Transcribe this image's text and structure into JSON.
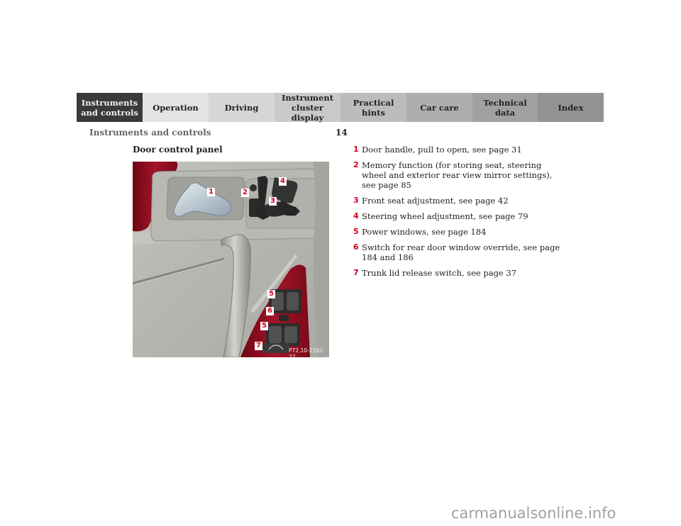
{
  "nav": {
    "tabs": [
      {
        "lines": [
          "Instruments",
          "and controls"
        ],
        "active": true
      },
      {
        "lines": [
          "Operation"
        ],
        "active": false
      },
      {
        "lines": [
          "Driving"
        ],
        "active": false
      },
      {
        "lines": [
          "Instrument",
          "cluster display"
        ],
        "active": false
      },
      {
        "lines": [
          "Practical hints"
        ],
        "active": false
      },
      {
        "lines": [
          "Car care"
        ],
        "active": false
      },
      {
        "lines": [
          "Technical",
          "data"
        ],
        "active": false
      },
      {
        "lines": [
          "Index"
        ],
        "active": false
      }
    ]
  },
  "header": {
    "running_head": "Instruments and controls",
    "page_number": "14"
  },
  "section": {
    "title": "Door control panel"
  },
  "figure": {
    "code": "P72.10-2162-27",
    "callouts": [
      "1",
      "2",
      "3",
      "4",
      "5",
      "6",
      "5",
      "7"
    ],
    "colors": {
      "trim_red": "#8c0a1c",
      "panel_gray": "#b6b6b1",
      "callout_red": "#d2001e"
    }
  },
  "legend": [
    {
      "num": "1",
      "text": "Door handle, pull to open, see page 31"
    },
    {
      "num": "2",
      "text": "Memory function (for storing seat, steering wheel and exterior rear view mirror settings), see page 85"
    },
    {
      "num": "3",
      "text": "Front seat adjustment, see page 42"
    },
    {
      "num": "4",
      "text": "Steering wheel adjustment, see page 79"
    },
    {
      "num": "5",
      "text": "Power windows, see page 184"
    },
    {
      "num": "6",
      "text": "Switch for rear door window override, see page 184 and 186"
    },
    {
      "num": "7",
      "text": "Trunk lid release switch, see page 37"
    }
  ],
  "footer": {
    "watermark": "carmanualsonline.info"
  }
}
